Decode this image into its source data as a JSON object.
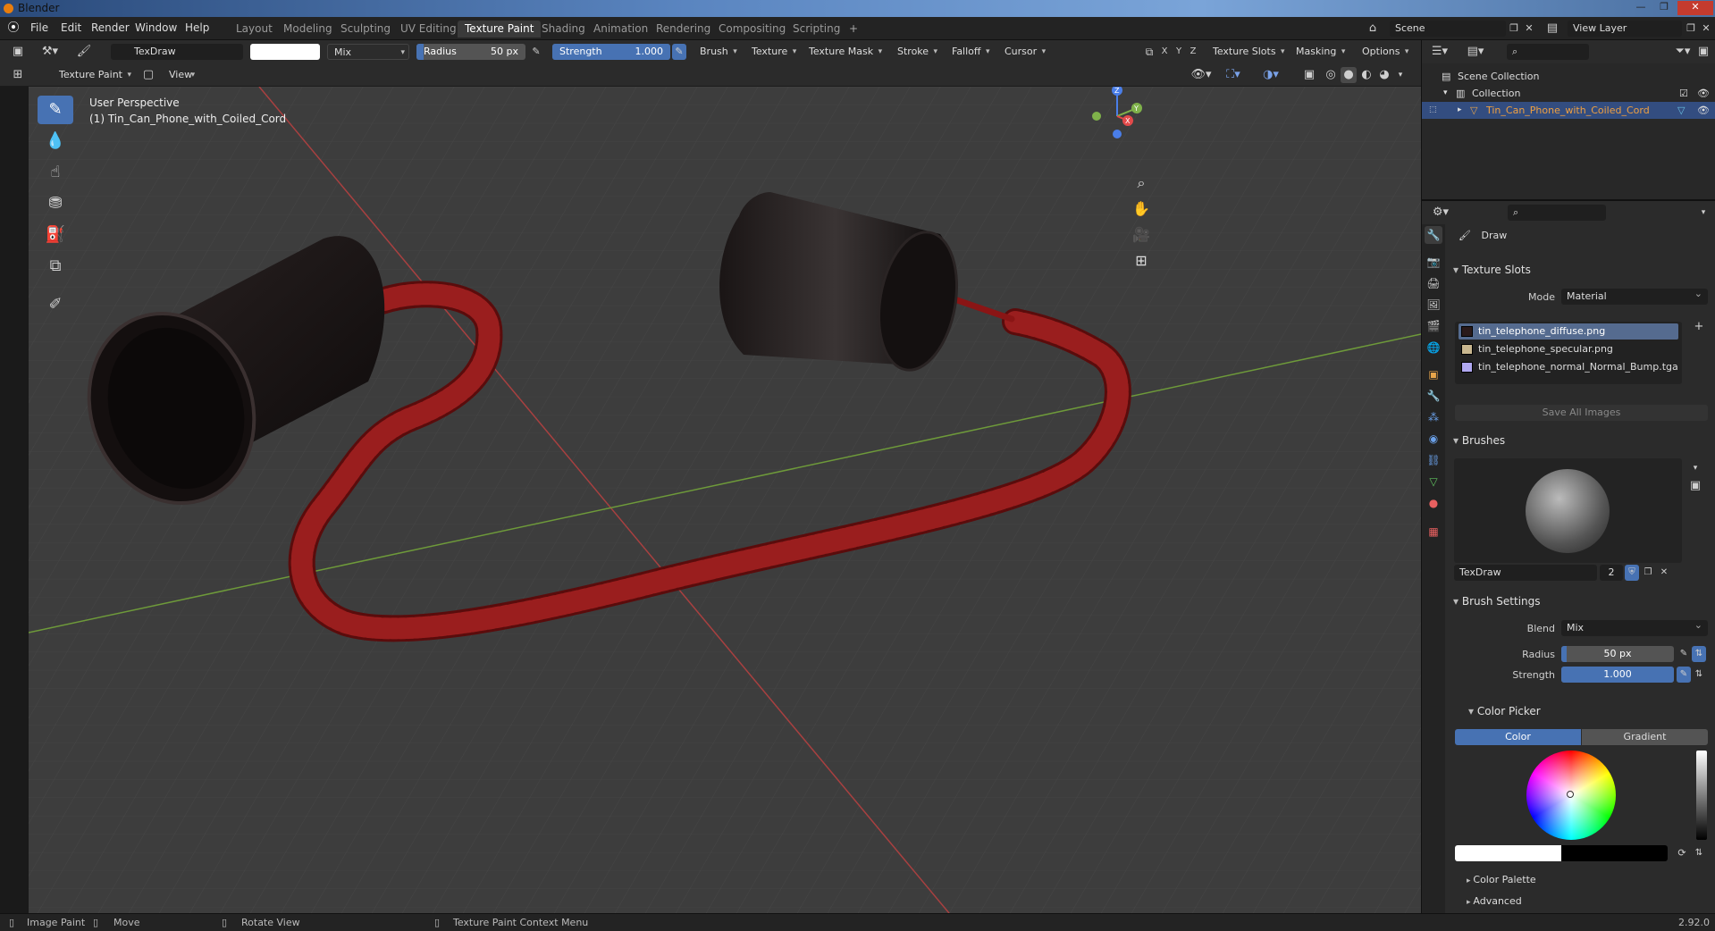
{
  "window": {
    "title": "Blender"
  },
  "menu": [
    "File",
    "Edit",
    "Render",
    "Window",
    "Help"
  ],
  "workspaces": [
    "Layout",
    "Modeling",
    "Sculpting",
    "UV Editing",
    "Texture Paint",
    "Shading",
    "Animation",
    "Rendering",
    "Compositing",
    "Scripting"
  ],
  "active_workspace": "Texture Paint",
  "scene": {
    "name": "Scene",
    "view_layer": "View Layer"
  },
  "tool_header": {
    "brush_name": "TexDraw",
    "blend": "Mix",
    "radius_label": "Radius",
    "radius_value": "50 px",
    "strength_label": "Strength",
    "strength_value": "1.000",
    "menus": [
      "Brush",
      "Texture",
      "Texture Mask",
      "Stroke",
      "Falloff",
      "Cursor"
    ],
    "axes": [
      "X",
      "Y",
      "Z"
    ],
    "right_menus": [
      "Texture Slots",
      "Masking",
      "Options"
    ]
  },
  "viewport_header": {
    "mode": "Texture Paint",
    "view_menu": "View"
  },
  "viewport": {
    "perspective": "User Perspective",
    "object_label": "(1) Tin_Can_Phone_with_Coiled_Cord",
    "gizmo_axes": [
      "Z",
      "Y",
      "X"
    ]
  },
  "outliner": {
    "root": "Scene Collection",
    "collection": "Collection",
    "object": "Tin_Can_Phone_with_Coiled_Cord"
  },
  "properties": {
    "tool_name": "Draw",
    "texture_slots": {
      "title": "Texture Slots",
      "mode_label": "Mode",
      "mode_value": "Material",
      "slots": [
        {
          "name": "tin_telephone_diffuse.png",
          "color": "#2a1a1a"
        },
        {
          "name": "tin_telephone_specular.png",
          "color": "#c9b78f"
        },
        {
          "name": "tin_telephone_normal_Normal_Bump.tga",
          "color": "#b0a8f0"
        }
      ],
      "save_all": "Save All Images"
    },
    "brushes": {
      "title": "Brushes",
      "brush_name": "TexDraw",
      "users": "2"
    },
    "brush_settings": {
      "title": "Brush Settings",
      "blend_label": "Blend",
      "blend_value": "Mix",
      "radius_label": "Radius",
      "radius_value": "50 px",
      "strength_label": "Strength",
      "strength_value": "1.000"
    },
    "color_picker": {
      "title": "Color Picker",
      "tab_color": "Color",
      "tab_gradient": "Gradient"
    },
    "color_palette": "Color Palette",
    "advanced": "Advanced"
  },
  "statusbar": {
    "items": [
      "Image Paint",
      "Move",
      "Rotate View",
      "Texture Paint Context Menu"
    ],
    "version": "2.92.0"
  },
  "colors": {
    "accent": "#4772b3",
    "cord": "#8a1515",
    "can": "#1a1414"
  }
}
